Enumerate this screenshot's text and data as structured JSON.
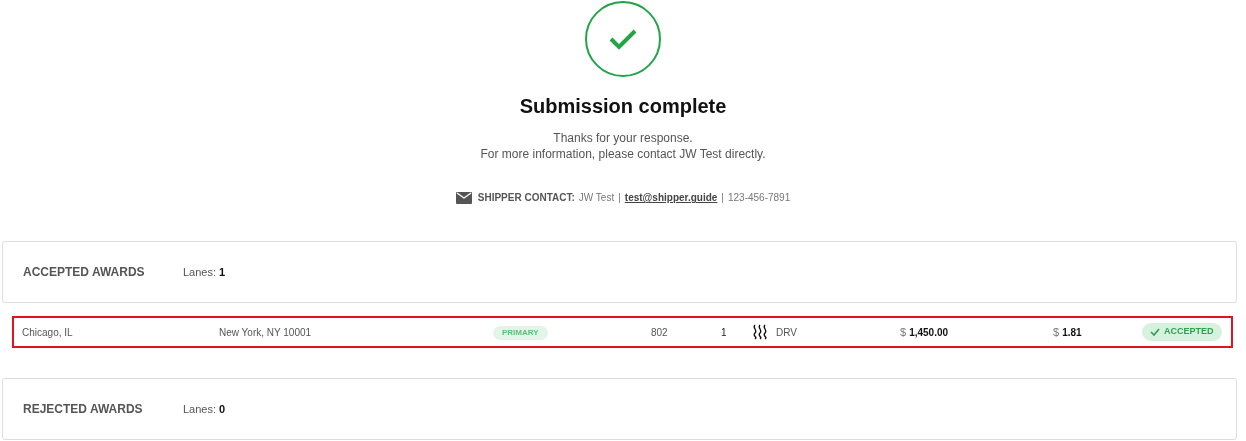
{
  "header": {
    "title": "Submission complete",
    "messages": [
      "Thanks for your response.",
      "For more information, please contact JW Test directly."
    ]
  },
  "contact": {
    "label": "SHIPPER CONTACT:",
    "name": "JW Test",
    "separator_1": "|",
    "email": "test@shipper.guide",
    "separator_2": "|",
    "phone": "123-456-7891"
  },
  "sections": [
    {
      "title": "ACCEPTED AWARDS",
      "lanes_label": "Lanes:",
      "lanes_count": "1",
      "rows": [
        {
          "origin": "Chicago, IL",
          "destination": "New York, NY 10001",
          "tag": "PRIMARY",
          "miles": "802",
          "loads": "1",
          "equipment": "DRV",
          "currency_1": "$",
          "rate": "1,450.00",
          "currency_2": "$",
          "rate_per_mile": "1.81",
          "status": "ACCEPTED",
          "highlighted": true
        }
      ]
    },
    {
      "title": "REJECTED AWARDS",
      "lanes_label": "Lanes:",
      "lanes_count": "0"
    }
  ]
}
